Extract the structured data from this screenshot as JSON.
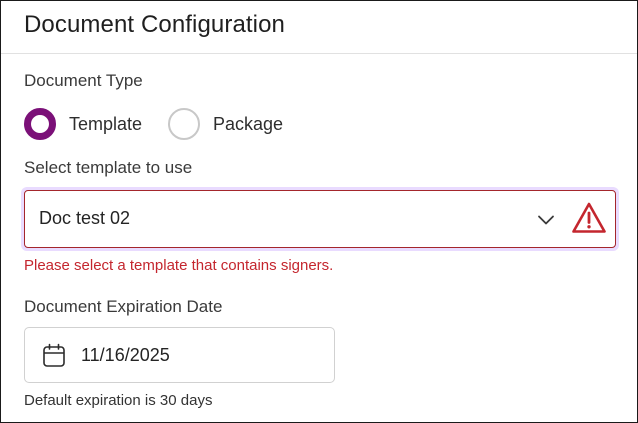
{
  "header": {
    "title": "Document Configuration"
  },
  "document_type": {
    "label": "Document Type",
    "options": [
      {
        "label": "Template",
        "selected": true
      },
      {
        "label": "Package",
        "selected": false
      }
    ]
  },
  "template_select": {
    "label": "Select template to use",
    "value": "Doc test 02",
    "error": "Please select a template that contains signers.",
    "chevron_icon": "chevron-down-icon",
    "status_icon": "warning-icon"
  },
  "expiration": {
    "label": "Document Expiration Date",
    "value": "11/16/2025",
    "hint": "Default expiration is 30 days",
    "icon": "calendar-icon"
  },
  "colors": {
    "accent": "#7b1078",
    "error": "#c4262e",
    "focus_ring": "#e9dbff"
  }
}
